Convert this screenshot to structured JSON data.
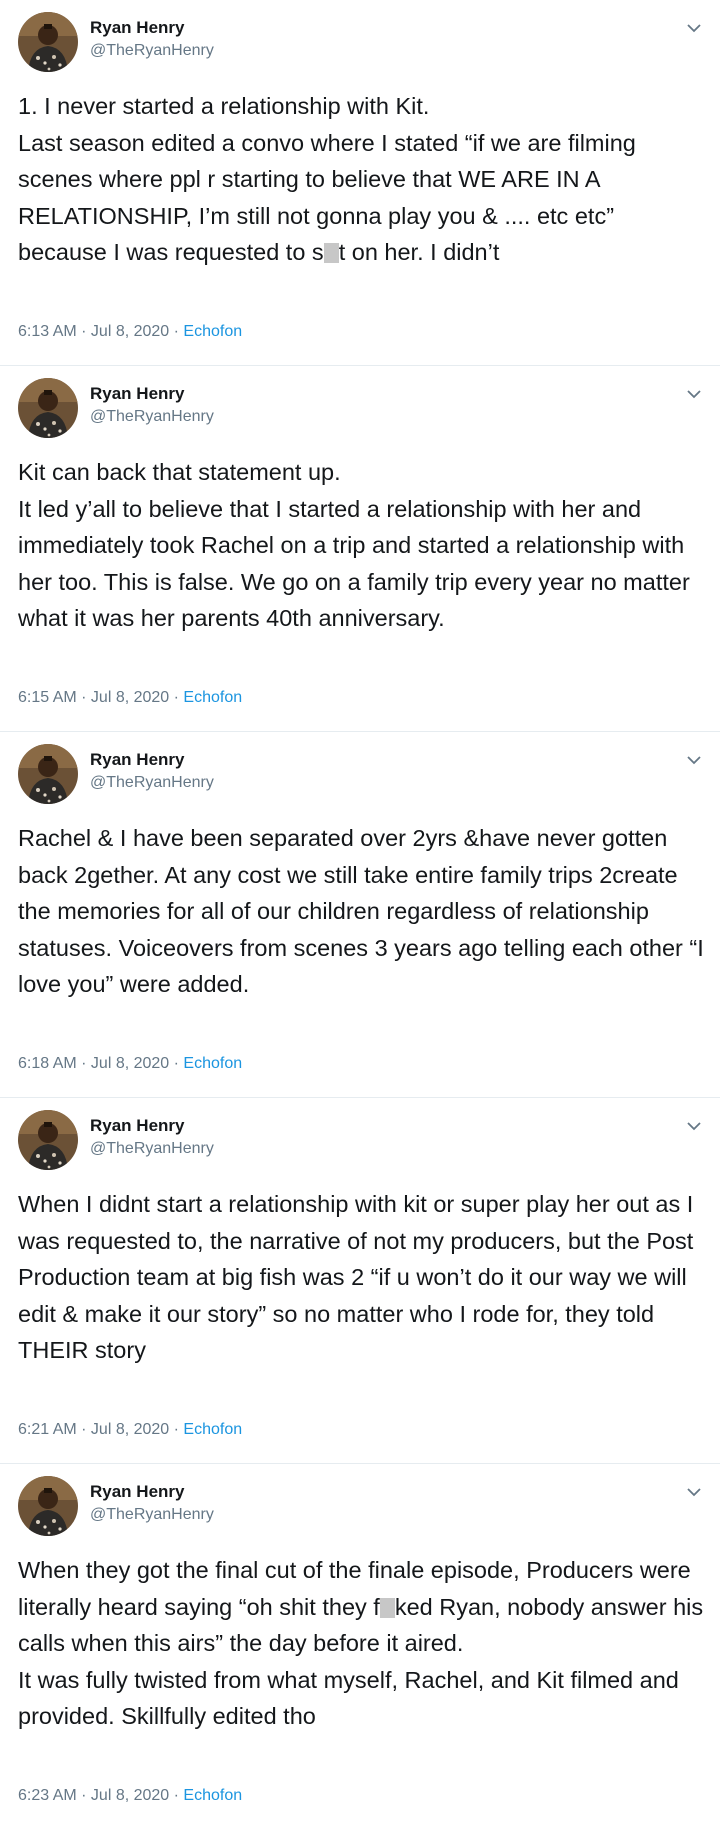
{
  "author": {
    "name": "Ryan Henry",
    "handle": "@TheRyanHenry"
  },
  "tweets": [
    {
      "text_parts": [
        "1. I never started a relationship with Kit.\nLast season edited a convo where I stated “if we are filming scenes where ppl r starting to believe that WE ARE IN A RELATIONSHIP, I’m still not gonna play you & .... etc etc” because I was requested to s",
        "t on her. I didn’t"
      ],
      "time": "6:13 AM · Jul 8, 2020 · ",
      "source": "Echofon"
    },
    {
      "text_parts": [
        "Kit can back that statement up.\nIt led y’all to believe that I started a relationship with her and immediately took Rachel on a trip and started a relationship with her too. This is false. We go on a family trip every year no matter what it was her parents 40th anniversary."
      ],
      "time": "6:15 AM · Jul 8, 2020 · ",
      "source": "Echofon"
    },
    {
      "text_parts": [
        "Rachel & I have been separated over 2yrs &have never gotten back 2gether. At any cost we still take entire family trips 2create the memories for all of our children regardless of relationship statuses. Voiceovers from scenes 3 years ago telling each other “I love you” were added."
      ],
      "time": "6:18 AM · Jul 8, 2020 · ",
      "source": "Echofon"
    },
    {
      "text_parts": [
        "When I didnt start a relationship with kit or super play her out as I was requested to, the narrative of not my producers, but the Post Production team at big fish was 2 “if u won’t do it our way we will edit & make it our story” so no matter who I rode for, they told THEIR story"
      ],
      "time": "6:21 AM · Jul 8, 2020 · ",
      "source": "Echofon"
    },
    {
      "text_parts": [
        "When they got the final cut of the finale episode, Producers were literally heard saying “oh shit they f",
        "ked Ryan, nobody answer his calls when this airs” the day before it aired.\nIt was fully twisted from what myself, Rachel, and Kit filmed and provided. Skillfully edited tho"
      ],
      "time": "6:23 AM · Jul 8, 2020 · ",
      "source": "Echofon"
    }
  ],
  "icons": {
    "more": "chevron-down-icon",
    "avatar": "profile-photo"
  },
  "colors": {
    "text": "#14171a",
    "secondary": "#657786",
    "link": "#1b95e0",
    "divider": "#e6ecf0"
  }
}
